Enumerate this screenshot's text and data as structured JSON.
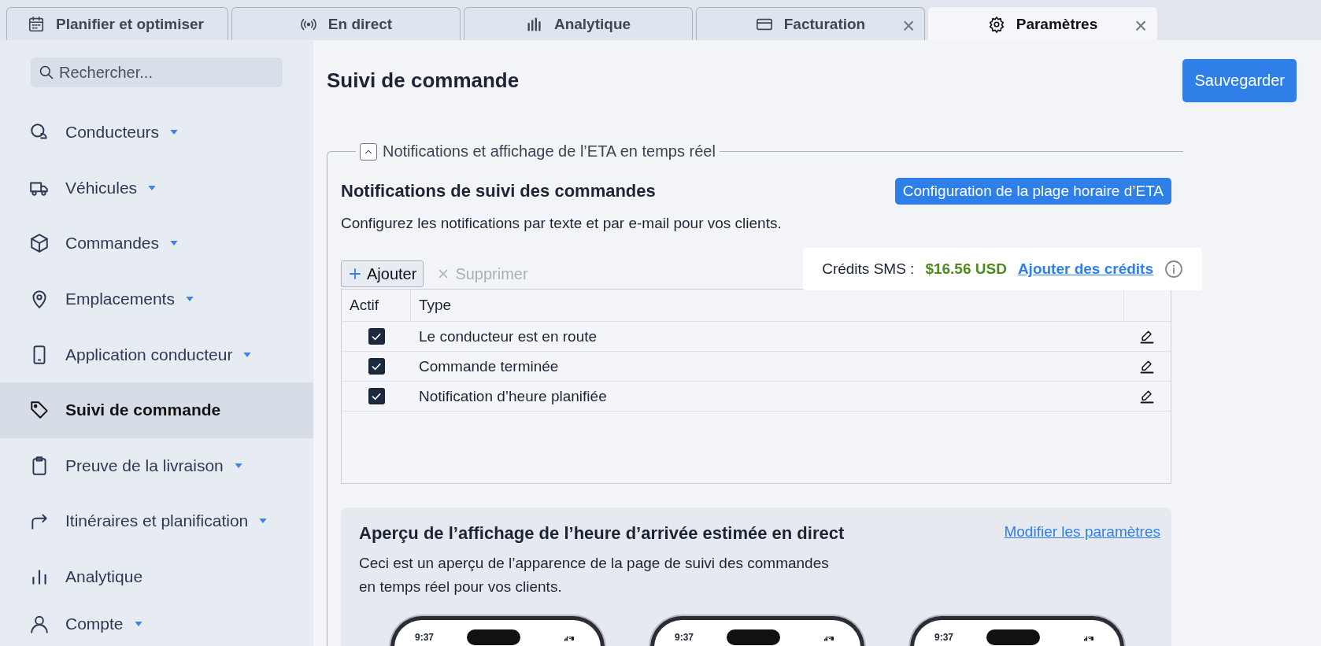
{
  "tabs": [
    {
      "label": "Planifier et optimiser",
      "selected": false,
      "closable": false
    },
    {
      "label": "En direct",
      "selected": false,
      "closable": false
    },
    {
      "label": "Analytique",
      "selected": false,
      "closable": false
    },
    {
      "label": "Facturation",
      "selected": false,
      "closable": true,
      "close": "×"
    },
    {
      "label": "Paramètres",
      "selected": true,
      "closable": true,
      "close": "×"
    }
  ],
  "sidebar": {
    "search": {
      "placeholder": "Rechercher..."
    },
    "items": [
      {
        "label": "Conducteurs",
        "expandable": true,
        "selected": false
      },
      {
        "label": "Véhicules",
        "expandable": true,
        "selected": false
      },
      {
        "label": "Commandes",
        "expandable": true,
        "selected": false
      },
      {
        "label": "Emplacements",
        "expandable": true,
        "selected": false
      },
      {
        "label": "Application conducteur",
        "expandable": true,
        "selected": false
      },
      {
        "label": "Suivi de commande",
        "expandable": false,
        "selected": true
      },
      {
        "label": "Preuve de la livraison",
        "expandable": true,
        "selected": false
      },
      {
        "label": "Itinéraires et planification",
        "expandable": true,
        "selected": false
      },
      {
        "label": "Analytique",
        "expandable": false,
        "selected": false
      },
      {
        "label": "Compte",
        "expandable": true,
        "selected": false
      }
    ]
  },
  "page": {
    "title": "Suivi de commande",
    "save_button": "Sauvegarder"
  },
  "section": {
    "legend": "Notifications et affichage de l’ETA en temps réel",
    "expanded": true,
    "heading": "Notifications de suivi des commandes",
    "config_button": "Configuration de la plage horaire d’ETA",
    "description": "Configurez les notifications par texte et par e-mail pour vos clients.",
    "toolbar": [
      {
        "label": "Ajouter",
        "disabled": false
      },
      {
        "label": "Supprimer",
        "disabled": true
      }
    ],
    "credits": {
      "label": "Crédits SMS :",
      "amount": "$16.56 USD",
      "link": "Ajouter des crédits"
    },
    "table": {
      "columns": [
        "Actif",
        "Type"
      ],
      "rows": [
        {
          "active": true,
          "type": "Le conducteur est en route"
        },
        {
          "active": true,
          "type": "Commande terminée"
        },
        {
          "active": true,
          "type": "Notification d’heure planifiée"
        }
      ]
    }
  },
  "preview": {
    "title": "Aperçu de l’affichage de l’heure d’arrivée estimée en direct",
    "link": "Modifier les paramètres",
    "description": "Ceci est un aperçu de l’apparence de la page de suivi des commandes en temps réel pour vos clients.",
    "phones": [
      {
        "time": "9:37"
      },
      {
        "time": "9:37"
      },
      {
        "time": "9:37"
      }
    ]
  }
}
